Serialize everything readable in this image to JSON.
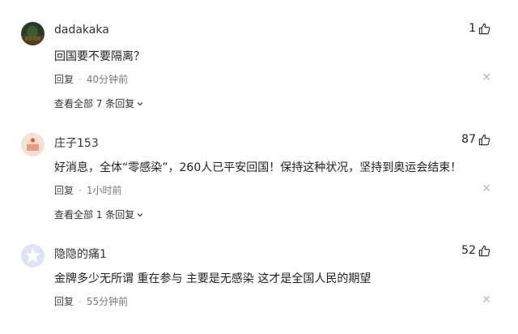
{
  "comments": [
    {
      "username": "dadakaka",
      "likes": "1",
      "text": "回国要不要隔离？",
      "reply_label": "回复",
      "time": "40分钟前",
      "view_replies": "查看全部 7 条回复",
      "avatar": "photo-avatar"
    },
    {
      "username": "庄子153",
      "likes": "87",
      "text": "好消息，全体“零感染”，260人已平安回国！保持这种状况，坚持到奥运会结束！",
      "reply_label": "回复",
      "time": "1小时前",
      "view_replies": "查看全部 1 条回复",
      "avatar": "cake-avatar"
    },
    {
      "username": "隐隐的痛1",
      "likes": "52",
      "text": "金牌多少无所谓 重在参与 主要是无感染 这才是全国人民的期望",
      "reply_label": "回复",
      "time": "55分钟前",
      "avatar": "default-star-avatar"
    }
  ],
  "icons": {
    "like": "thumbs-up-icon",
    "close": "close-icon",
    "expand": "chevron-down-icon"
  },
  "colors": {
    "meta": "#777777",
    "close": "#bbbbbb"
  }
}
